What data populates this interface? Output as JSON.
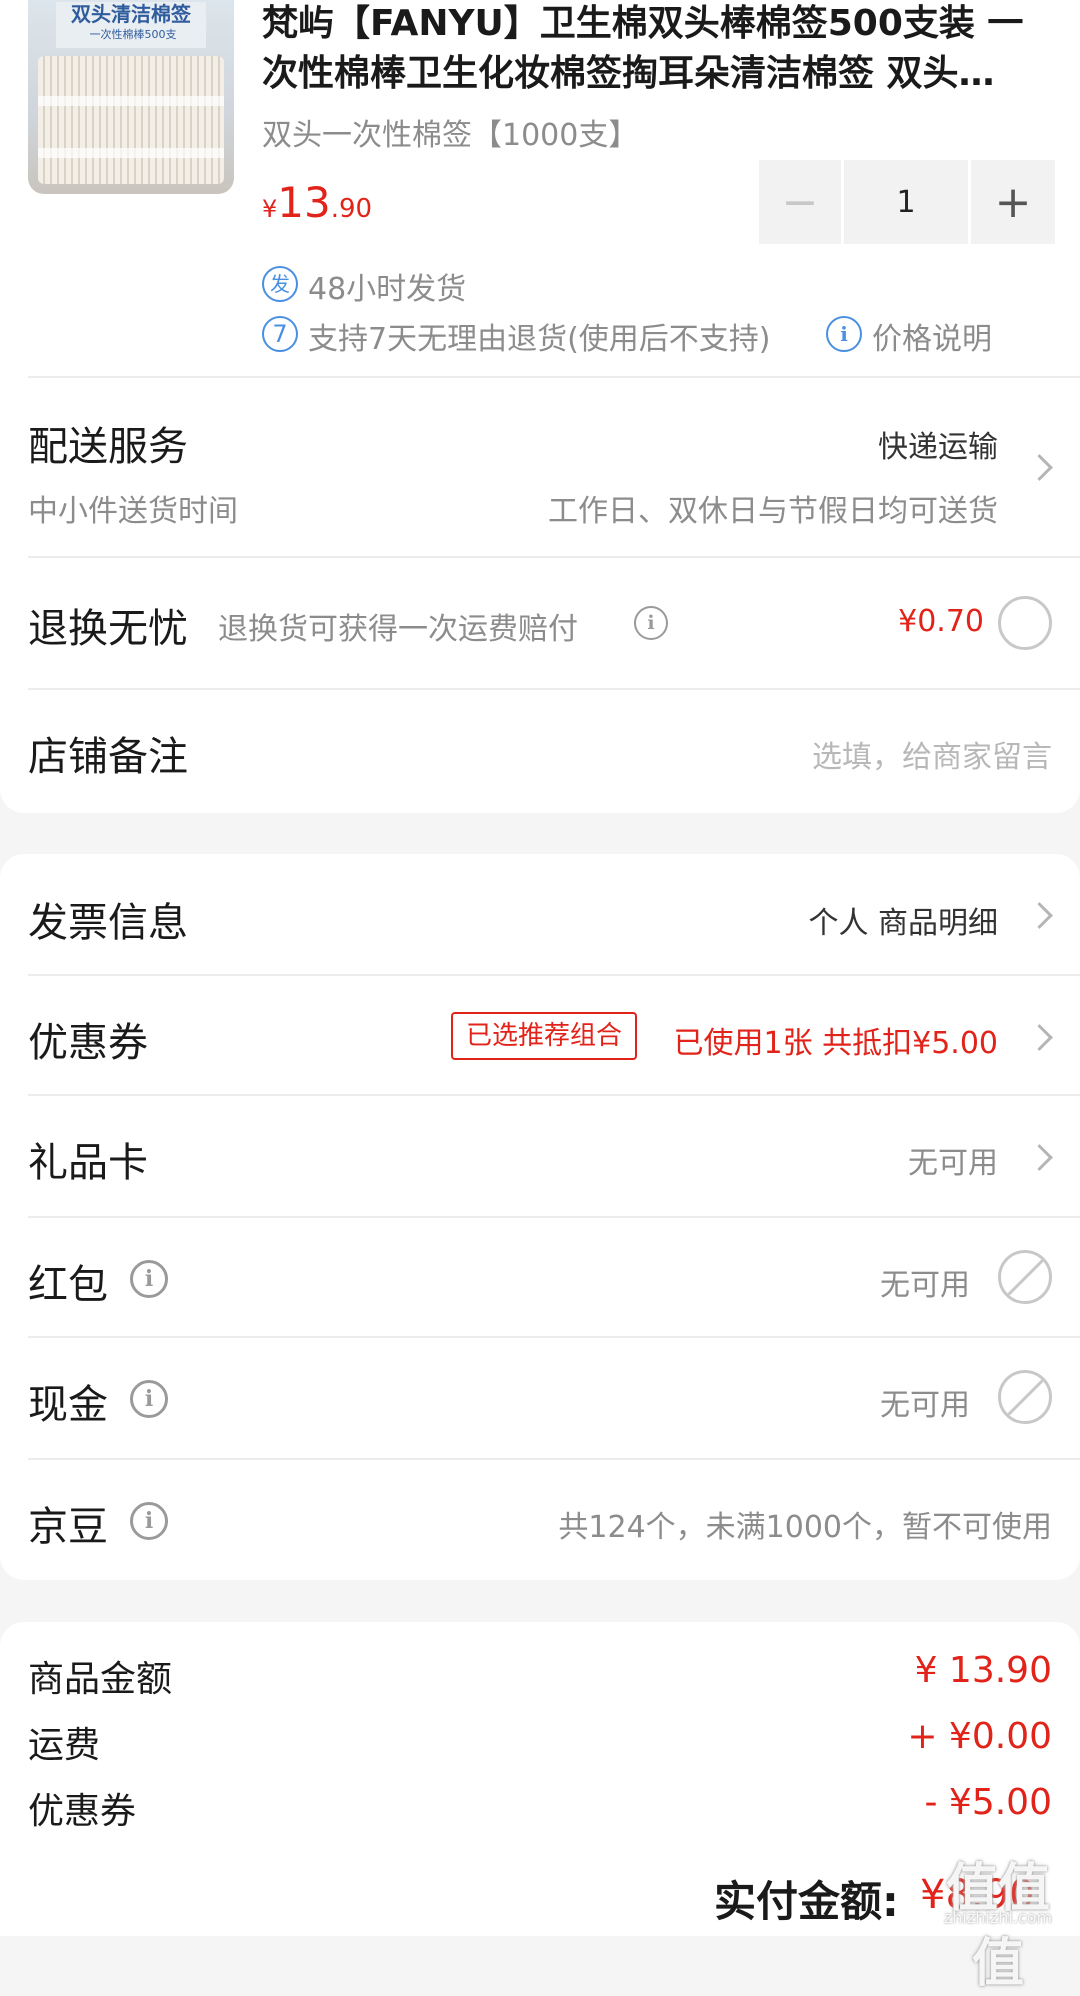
{
  "product": {
    "title_line1": "梵屿【FANYU】卫生棉双头棒棉签500支装 一",
    "title_line2": "次性棉棒卫生化妆棉签掏耳朵清洁棉签 双头…",
    "variant": "双头一次性棉签【1000支】",
    "price_symbol": "¥",
    "price_int": "13",
    "price_dec": ".90",
    "quantity": "1",
    "image": {
      "pack_title": "双头清洁棉签",
      "pack_subtitle": "一次性棉棒500支"
    },
    "shipping_badge": "发",
    "shipping_text": "48小时发货",
    "return_badge": "7",
    "return_text": "支持7天无理由退货(使用后不支持)",
    "price_note_icon": "i",
    "price_note": "价格说明"
  },
  "delivery": {
    "label": "配送服务",
    "method": "快递运输",
    "sub_label": "中小件送货时间",
    "sub_value": "工作日、双休日与节假日均可送货"
  },
  "return_worry": {
    "label": "退换无忧",
    "desc": "退换货可获得一次运费赔付",
    "price": "¥0.70"
  },
  "shop_note": {
    "label": "店铺备注",
    "placeholder": "选填，给商家留言"
  },
  "invoice": {
    "label": "发票信息",
    "value": "个人 商品明细"
  },
  "coupon": {
    "label": "优惠券",
    "tag": "已选推荐组合",
    "value": "已使用1张 共抵扣¥5.00"
  },
  "gift_card": {
    "label": "礼品卡",
    "value": "无可用"
  },
  "red_packet": {
    "label": "红包",
    "value": "无可用"
  },
  "cash": {
    "label": "现金",
    "value": "无可用"
  },
  "jingdou": {
    "label": "京豆",
    "value": "共124个，未满1000个，暂不可使用"
  },
  "summary": {
    "goods_label": "商品金额",
    "goods_value": "¥ 13.90",
    "freight_label": "运费",
    "freight_value": "+ ¥0.00",
    "coupon_label": "优惠券",
    "coupon_value": "- ¥5.00",
    "total_label": "实付金额:",
    "total_value": "¥8.90"
  },
  "watermark": {
    "text": "值值值",
    "sub": "zhizhizhi.com"
  },
  "colors": {
    "accent_red": "#e2231a",
    "info_blue": "#4a90e2",
    "page_bg": "#f5f5f5"
  }
}
